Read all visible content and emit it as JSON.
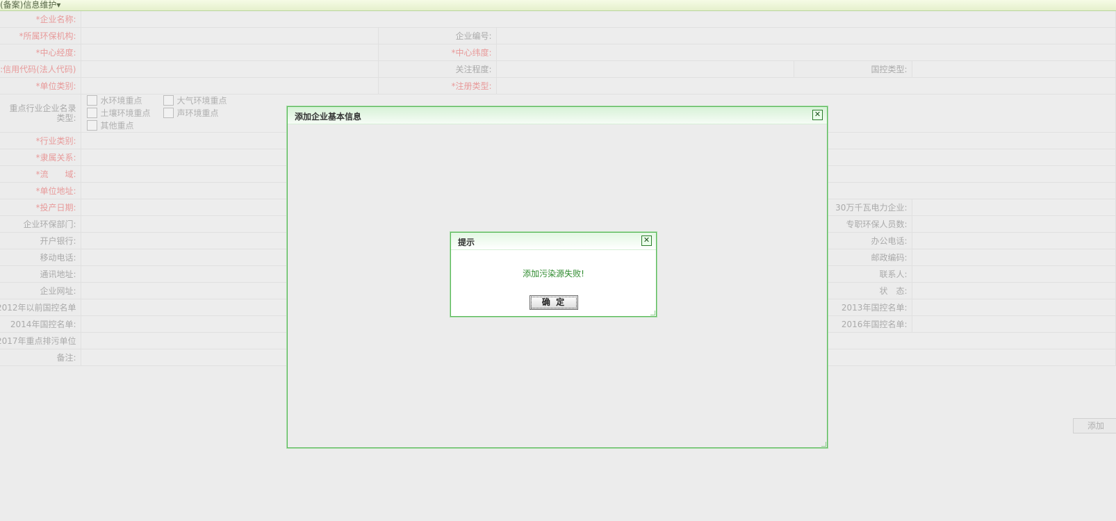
{
  "header": {
    "title": "(备案)信息维护▾"
  },
  "form": {
    "company_name": "*企业名称:",
    "env_org": "*所属环保机构:",
    "company_no": "企业编号:",
    "center_lng": "*中心经度:",
    "center_lat": "*中心纬度:",
    "credit_code": "信用代码(法人代码):",
    "attention": "关注程度:",
    "control_type": "国控类型:",
    "unit_category": "*单位类别:",
    "reg_type": "*注册类型:",
    "key_industry": "重点行业企业名录类型:",
    "checkboxes": [
      "水环境重点",
      "大气环境重点",
      "土壤环境重点",
      "声环境重点",
      "其他重点"
    ],
    "industry_category": "*行业类别:",
    "affiliation": "*隶属关系:",
    "basin": "*流　　域:",
    "unit_address": "*单位地址:",
    "start_date": "*投产日期:",
    "power_300k": "30万千瓦电力企业:",
    "env_dept": "企业环保部门:",
    "env_staff": "专职环保人员数:",
    "bank": "开户银行:",
    "office_phone": "办公电话:",
    "mobile": "移动电话:",
    "postcode": "邮政编码:",
    "mail_address": "通讯地址:",
    "contact": "联系人:",
    "website": "企业网址:",
    "status": "状　态:",
    "list_before_2012": "2012年以前国控名单:",
    "list_2013": "2013年国控名单:",
    "list_2014": "2014年国控名单:",
    "list_2016": "2016年国控名单:",
    "key_2017": "2017年重点排污单位:",
    "remark": "备注:"
  },
  "add_button": "添加",
  "outer_dialog": {
    "title": "添加企业基本信息",
    "close": "✕"
  },
  "inner_dialog": {
    "title": "提示",
    "message": "添加污染源失败!",
    "ok": "确 定",
    "close": "✕"
  }
}
